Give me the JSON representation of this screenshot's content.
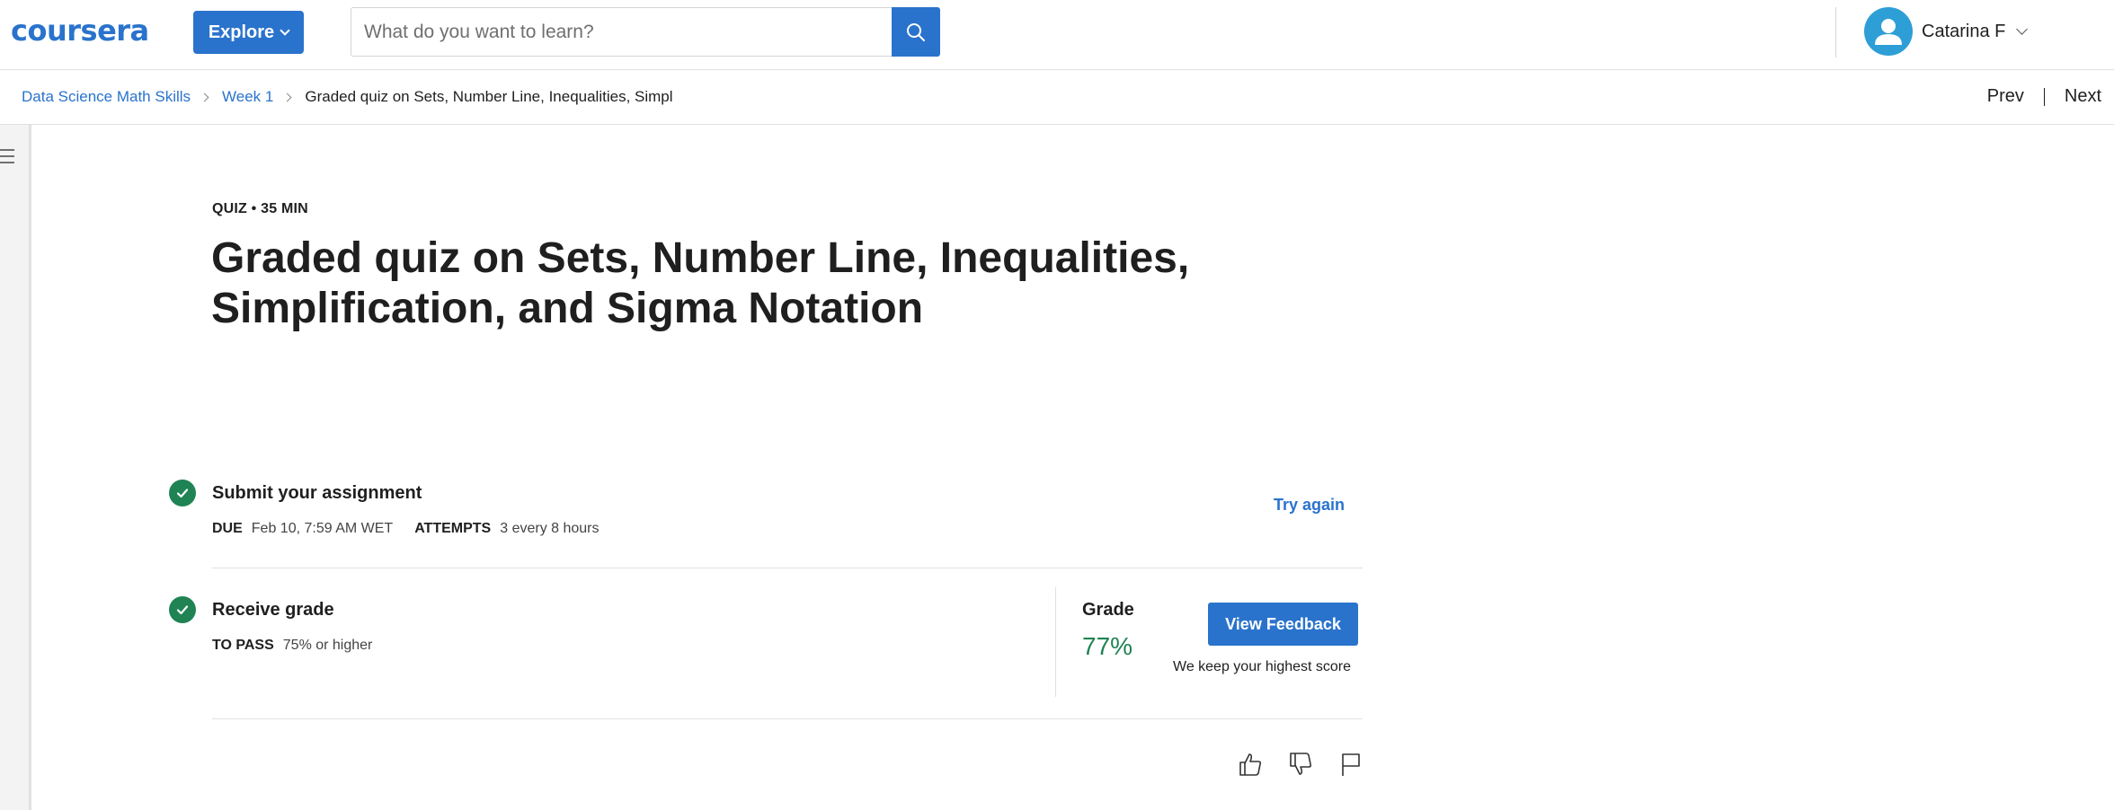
{
  "header": {
    "logo": "coursera",
    "explore_label": "Explore",
    "search_placeholder": "What do you want to learn?",
    "user_name": "Catarina F"
  },
  "breadcrumb": {
    "items": [
      "Data Science Math Skills",
      "Week 1"
    ],
    "current": "Graded quiz on Sets, Number Line, Inequalities, Simpl"
  },
  "nav": {
    "prev": "Prev",
    "next": "Next"
  },
  "quiz": {
    "kicker": "QUIZ • 35 MIN",
    "title": "Graded quiz on Sets, Number Line, Inequalities, Simplification, and Sigma Notation"
  },
  "submit_step": {
    "title": "Submit your assignment",
    "due_label": "DUE",
    "due_value": "Feb 10, 7:59 AM WET",
    "attempts_label": "ATTEMPTS",
    "attempts_value": "3 every 8 hours",
    "action": "Try again"
  },
  "grade_step": {
    "title": "Receive grade",
    "pass_label": "TO PASS",
    "pass_value": "75% or higher",
    "grade_label": "Grade",
    "grade_value": "77%",
    "feedback_button": "View Feedback",
    "note": "We keep your highest score"
  },
  "icons": [
    "search-icon",
    "user-icon",
    "menu-icon",
    "check-icon",
    "thumbs-up-icon",
    "thumbs-down-icon",
    "flag-icon"
  ],
  "colors": {
    "primary": "#2a73cc",
    "success": "#1f8354",
    "avatar": "#2e9ed6"
  }
}
